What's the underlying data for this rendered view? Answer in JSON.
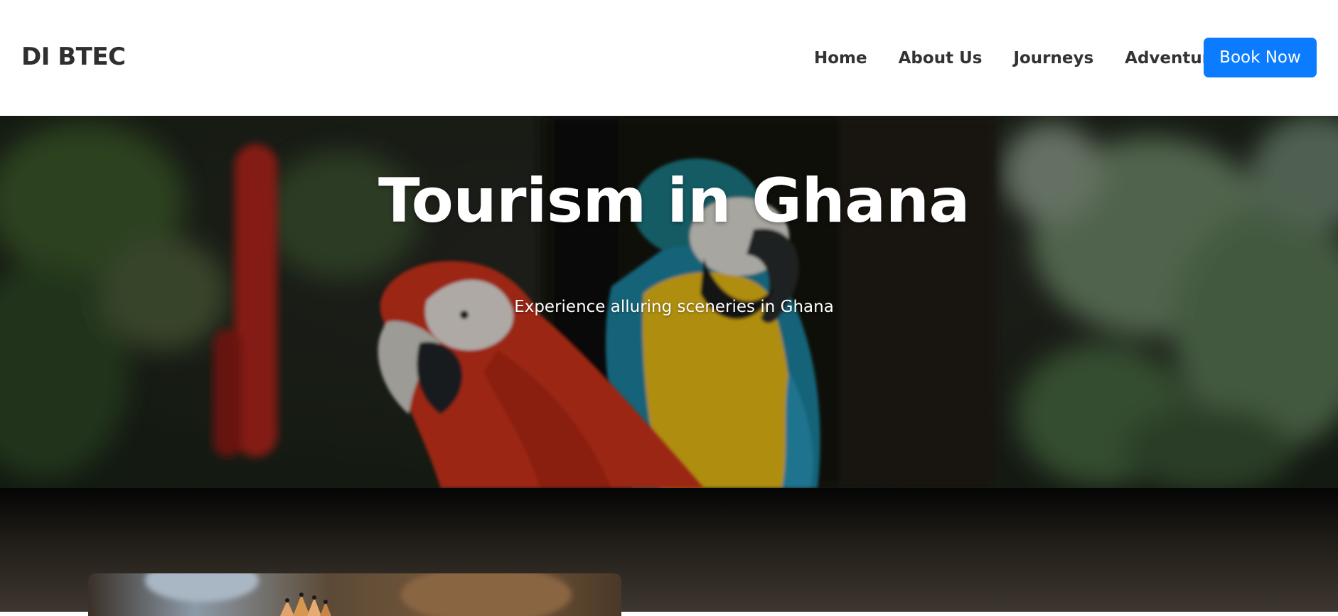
{
  "navbar": {
    "brand": "DI BTEC",
    "links": [
      "Home",
      "About Us",
      "Journeys",
      "Adventure"
    ],
    "cta_label": "Book Now"
  },
  "hero": {
    "title": "Tourism in Ghana",
    "subtitle": "Experience alluring sceneries in Ghana"
  },
  "colors": {
    "accent": "#0b7cff",
    "nav_text": "#333333",
    "hero_text": "#ffffff"
  }
}
